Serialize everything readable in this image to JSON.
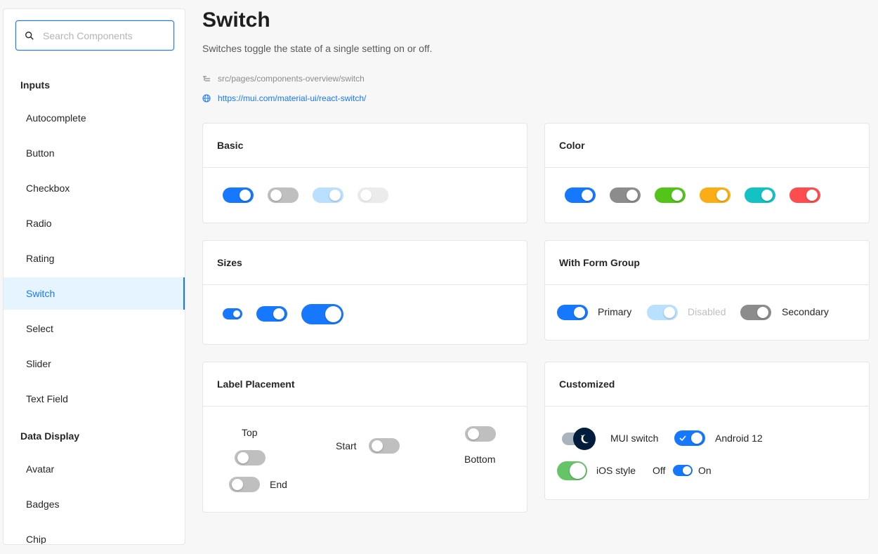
{
  "search": {
    "placeholder": "Search Components"
  },
  "sidebar": {
    "groups": [
      "Inputs",
      "Data Display"
    ],
    "items": [
      "Autocomplete",
      "Button",
      "Checkbox",
      "Radio",
      "Rating",
      "Switch",
      "Select",
      "Slider",
      "Text Field"
    ],
    "items2": [
      "Avatar",
      "Badges",
      "Chip"
    ],
    "active": "Switch"
  },
  "header": {
    "title": "Switch",
    "description": "Switches toggle the state of a single setting on or off.",
    "path": "src/pages/components-overview/switch",
    "link": "https://mui.com/material-ui/react-switch/"
  },
  "cards": {
    "basic": "Basic",
    "color": "Color",
    "sizes": "Sizes",
    "form_group": "With Form Group",
    "label_placement": "Label Placement",
    "customized": "Customized"
  },
  "form_group": {
    "primary": "Primary",
    "disabled": "Disabled",
    "secondary": "Secondary"
  },
  "placement": {
    "top": "Top",
    "start": "Start",
    "bottom": "Bottom",
    "end": "End"
  },
  "customized": {
    "mui": "MUI switch",
    "android": "Android 12",
    "ios": "iOS style",
    "off": "Off",
    "on": "On"
  },
  "colors": {
    "primary": "#1677ff",
    "primary_light": "#bae0ff",
    "grey": "#8c8c8c",
    "off": "#bfbfbf",
    "success": "#52c41a",
    "warning": "#faad14",
    "info": "#13c2c2",
    "error": "#ff4d4f",
    "ios_green": "#65c466",
    "mui_dark": "#001e3c",
    "mui_track": "#aab4be"
  },
  "switches": {
    "basic": [
      true,
      false,
      true,
      false
    ],
    "basic_disabled": [
      false,
      false,
      true,
      true
    ],
    "color": [
      "primary",
      "grey",
      "success",
      "warning",
      "info",
      "error"
    ],
    "form_group": [
      true,
      true,
      true
    ],
    "placement": [
      false,
      false,
      false,
      false
    ],
    "mui_dark_mode": true,
    "android": true,
    "ios": true,
    "off_on": true
  }
}
